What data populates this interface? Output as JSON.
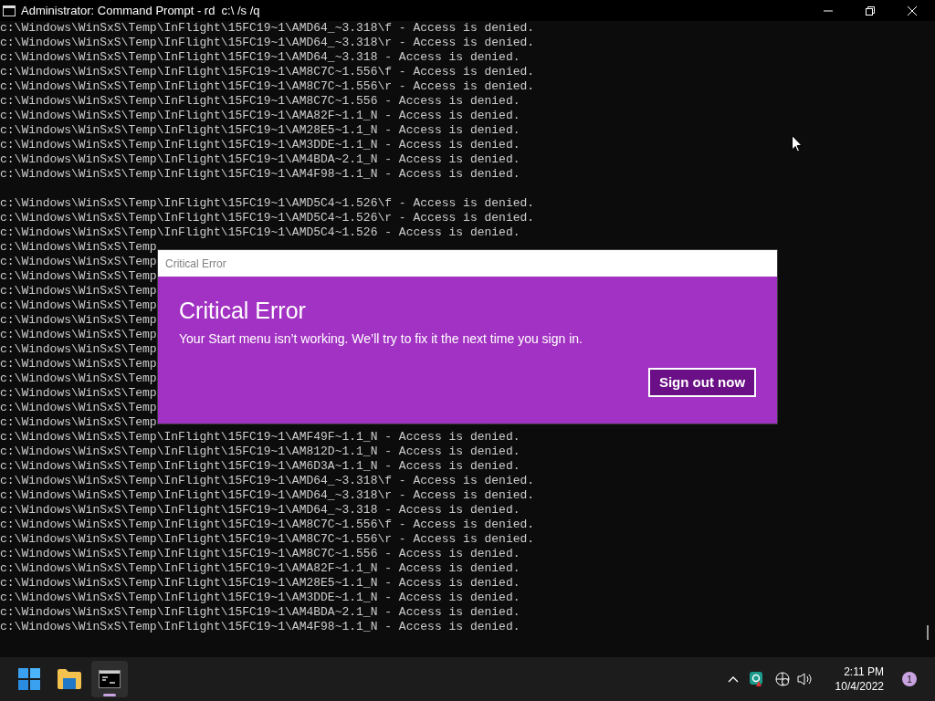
{
  "window": {
    "title": "Administrator: Command Prompt - rd  c:\\ /s /q"
  },
  "console": {
    "blocks": [
      [
        "c:\\Windows\\WinSxS\\Temp\\InFlight\\15FC19~1\\AMD64_~3.318\\f - Access is denied.",
        "c:\\Windows\\WinSxS\\Temp\\InFlight\\15FC19~1\\AMD64_~3.318\\r - Access is denied.",
        "c:\\Windows\\WinSxS\\Temp\\InFlight\\15FC19~1\\AMD64_~3.318 - Access is denied.",
        "c:\\Windows\\WinSxS\\Temp\\InFlight\\15FC19~1\\AM8C7C~1.556\\f - Access is denied.",
        "c:\\Windows\\WinSxS\\Temp\\InFlight\\15FC19~1\\AM8C7C~1.556\\r - Access is denied.",
        "c:\\Windows\\WinSxS\\Temp\\InFlight\\15FC19~1\\AM8C7C~1.556 - Access is denied.",
        "c:\\Windows\\WinSxS\\Temp\\InFlight\\15FC19~1\\AMA82F~1.1_N - Access is denied.",
        "c:\\Windows\\WinSxS\\Temp\\InFlight\\15FC19~1\\AM28E5~1.1_N - Access is denied.",
        "c:\\Windows\\WinSxS\\Temp\\InFlight\\15FC19~1\\AM3DDE~1.1_N - Access is denied.",
        "c:\\Windows\\WinSxS\\Temp\\InFlight\\15FC19~1\\AM4BDA~2.1_N - Access is denied.",
        "c:\\Windows\\WinSxS\\Temp\\InFlight\\15FC19~1\\AM4F98~1.1_N - Access is denied."
      ],
      [
        "c:\\Windows\\WinSxS\\Temp\\InFlight\\15FC19~1\\AMD5C4~1.526\\f - Access is denied.",
        "c:\\Windows\\WinSxS\\Temp\\InFlight\\15FC19~1\\AMD5C4~1.526\\r - Access is denied.",
        "c:\\Windows\\WinSxS\\Temp\\InFlight\\15FC19~1\\AMD5C4~1.526 - Access is denied.",
        "c:\\Windows\\WinSxS\\Temp",
        "c:\\Windows\\WinSxS\\Temp",
        "c:\\Windows\\WinSxS\\Temp",
        "c:\\Windows\\WinSxS\\Temp",
        "c:\\Windows\\WinSxS\\Temp",
        "c:\\Windows\\WinSxS\\Temp",
        "c:\\Windows\\WinSxS\\Temp",
        "c:\\Windows\\WinSxS\\Temp",
        "c:\\Windows\\WinSxS\\Temp",
        "c:\\Windows\\WinSxS\\Temp",
        "c:\\Windows\\WinSxS\\Temp",
        "c:\\Windows\\WinSxS\\Temp",
        "c:\\Windows\\WinSxS\\Temp",
        "c:\\Windows\\WinSxS\\Temp\\InFlight\\15FC19~1\\AMF49F~1.1_N - Access is denied.",
        "c:\\Windows\\WinSxS\\Temp\\InFlight\\15FC19~1\\AM812D~1.1_N - Access is denied.",
        "c:\\Windows\\WinSxS\\Temp\\InFlight\\15FC19~1\\AM6D3A~1.1_N - Access is denied.",
        "c:\\Windows\\WinSxS\\Temp\\InFlight\\15FC19~1\\AMD64_~3.318\\f - Access is denied.",
        "c:\\Windows\\WinSxS\\Temp\\InFlight\\15FC19~1\\AMD64_~3.318\\r - Access is denied.",
        "c:\\Windows\\WinSxS\\Temp\\InFlight\\15FC19~1\\AMD64_~3.318 - Access is denied.",
        "c:\\Windows\\WinSxS\\Temp\\InFlight\\15FC19~1\\AM8C7C~1.556\\f - Access is denied.",
        "c:\\Windows\\WinSxS\\Temp\\InFlight\\15FC19~1\\AM8C7C~1.556\\r - Access is denied.",
        "c:\\Windows\\WinSxS\\Temp\\InFlight\\15FC19~1\\AM8C7C~1.556 - Access is denied.",
        "c:\\Windows\\WinSxS\\Temp\\InFlight\\15FC19~1\\AMA82F~1.1_N - Access is denied.",
        "c:\\Windows\\WinSxS\\Temp\\InFlight\\15FC19~1\\AM28E5~1.1_N - Access is denied.",
        "c:\\Windows\\WinSxS\\Temp\\InFlight\\15FC19~1\\AM3DDE~1.1_N - Access is denied.",
        "c:\\Windows\\WinSxS\\Temp\\InFlight\\15FC19~1\\AM4BDA~2.1_N - Access is denied.",
        "c:\\Windows\\WinSxS\\Temp\\InFlight\\15FC19~1\\AM4F98~1.1_N - Access is denied."
      ]
    ]
  },
  "dialog": {
    "window_title": "Critical Error",
    "heading": "Critical Error",
    "message": "Your Start menu isn’t working. We’ll try to fix it the next time you sign in.",
    "button": "Sign out now"
  },
  "taskbar": {
    "apps": [
      {
        "kind": "start",
        "active": false
      },
      {
        "kind": "explorer",
        "active": false
      },
      {
        "kind": "terminal",
        "active": true
      }
    ],
    "time": "2:11 PM",
    "date": "10/4/2022",
    "notification_count": "1"
  }
}
